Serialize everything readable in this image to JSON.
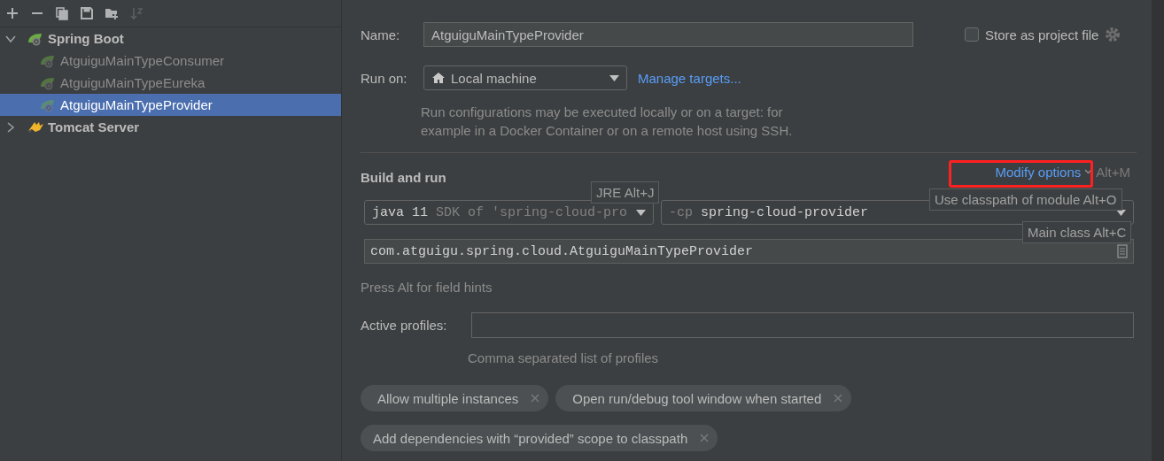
{
  "toolbar": [
    {
      "kind": "add",
      "disabled": false
    },
    {
      "kind": "remove",
      "disabled": false
    },
    {
      "kind": "copy",
      "disabled": false
    },
    {
      "kind": "save",
      "disabled": false
    },
    {
      "kind": "folder",
      "disabled": false
    },
    {
      "kind": "sort",
      "disabled": true
    }
  ],
  "tree": [
    {
      "label": "Spring Boot",
      "kind": "spring",
      "expanded": true,
      "selected": false,
      "children": [
        {
          "label": "AtguiguMainTypeConsumer",
          "kind": "spring",
          "selected": false
        },
        {
          "label": "AtguiguMainTypeEureka",
          "kind": "spring",
          "selected": false
        },
        {
          "label": "AtguiguMainTypeProvider",
          "kind": "spring",
          "selected": true
        }
      ]
    },
    {
      "label": "Tomcat Server",
      "kind": "tomcat",
      "expanded": false,
      "selected": false
    }
  ],
  "name": {
    "label": "Name:",
    "value": "AtguiguMainTypeProvider"
  },
  "store_as_project_file": {
    "label": "Store as project file",
    "checked": false
  },
  "run_on": {
    "label": "Run on:",
    "value": "Local machine",
    "link": "Manage targets...",
    "description": "Run configurations may be executed locally or on a target: for example in a Docker Container or on a remote host using SSH."
  },
  "build_and_run": {
    "title": "Build and run",
    "modify_options": "Modify options",
    "modify_shortcut": "Alt+M",
    "jre": {
      "version": "java 11",
      "detail": "SDK of 'spring-cloud-pro"
    },
    "classpath": {
      "flag": "-cp",
      "module": "spring-cloud-provider"
    },
    "main_class": "com.atguigu.spring.cloud.AtguiguMainTypeProvider",
    "hints": [
      {
        "text": "JRE Alt+J"
      },
      {
        "text": "Use classpath of module Alt+O"
      },
      {
        "text": "Main class Alt+C"
      }
    ]
  },
  "field_hint": "Press Alt for field hints",
  "active_profiles": {
    "label": "Active profiles:",
    "hint": "Comma separated list of profiles"
  },
  "options": [
    "Allow multiple instances",
    "Open run/debug tool window when started",
    "Add dependencies with “provided” scope to classpath"
  ]
}
